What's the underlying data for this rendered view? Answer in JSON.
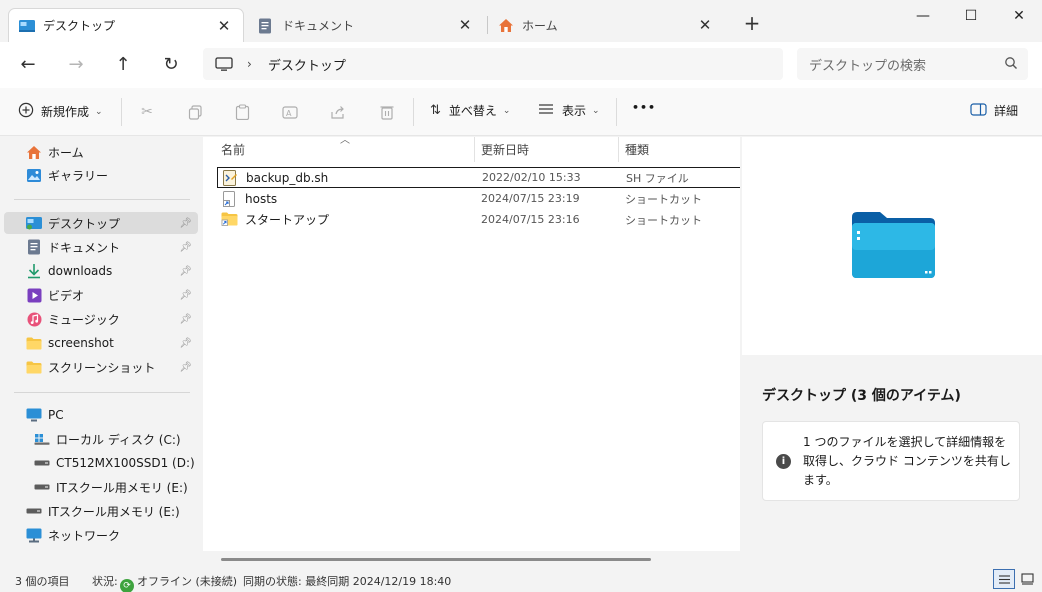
{
  "tabs": [
    {
      "label": "デスクトップ",
      "icon": "desktop-icon",
      "active": true
    },
    {
      "label": "ドキュメント",
      "icon": "document-icon",
      "active": false
    },
    {
      "label": "ホーム",
      "icon": "home-icon",
      "active": false
    }
  ],
  "new_tab_label": "+",
  "window_controls": {
    "minimize": "—",
    "maximize": "☐",
    "close": "✕"
  },
  "nav": {
    "back": "←",
    "forward": "→",
    "up": "↑",
    "refresh": "↻"
  },
  "address": {
    "chevron": "›",
    "path": "デスクトップ"
  },
  "search": {
    "placeholder": "デスクトップの検索"
  },
  "commandbar": {
    "new_label": "新規作成",
    "sort_label": "並べ替え",
    "view_label": "表示",
    "more_label": "•••",
    "details_label": "詳細"
  },
  "sidebar": {
    "top": [
      {
        "label": "ホーム",
        "icon": "home-icon"
      },
      {
        "label": "ギャラリー",
        "icon": "gallery-icon"
      }
    ],
    "quick": [
      {
        "label": "デスクトップ",
        "icon": "desktop-icon",
        "pinned": true,
        "selected": true
      },
      {
        "label": "ドキュメント",
        "icon": "document-icon",
        "pinned": true
      },
      {
        "label": "downloads",
        "icon": "download-icon",
        "pinned": true
      },
      {
        "label": "ビデオ",
        "icon": "video-icon",
        "pinned": true
      },
      {
        "label": "ミュージック",
        "icon": "music-icon",
        "pinned": true
      },
      {
        "label": "screenshot",
        "icon": "folder-icon",
        "pinned": true
      },
      {
        "label": "スクリーンショット",
        "icon": "folder-icon",
        "pinned": true
      }
    ],
    "pc": {
      "label": "PC",
      "icon": "pc-icon"
    },
    "drives": [
      {
        "label": "ローカル ディスク (C:)",
        "icon": "drive-icon"
      },
      {
        "label": "CT512MX100SSD1 (D:)",
        "icon": "drive-icon"
      },
      {
        "label": "ITスクール用メモリ (E:)",
        "icon": "usb-drive-icon"
      }
    ],
    "bottom": [
      {
        "label": "ITスクール用メモリ (E:)",
        "icon": "usb-drive-icon"
      },
      {
        "label": "ネットワーク",
        "icon": "network-icon"
      }
    ]
  },
  "columns": {
    "name": "名前",
    "modified": "更新日時",
    "type": "種類"
  },
  "files": [
    {
      "name": "backup_db.sh",
      "modified": "2022/02/10 15:33",
      "type": "SH ファイル",
      "icon": "script-file-icon"
    },
    {
      "name": "hosts",
      "modified": "2024/07/15 23:19",
      "type": "ショートカット",
      "icon": "shortcut-file-icon"
    },
    {
      "name": "スタートアップ",
      "modified": "2024/07/15 23:16",
      "type": "ショートカット",
      "icon": "folder-shortcut-icon"
    }
  ],
  "details": {
    "title": "デスクトップ (3 個のアイテム)",
    "info": "1 つのファイルを選択して詳細情報を取得し、クラウド コンテンツを共有します。"
  },
  "status": {
    "count": "3 個の項目",
    "state_label": "状況:",
    "state_value": "オフライン (未接続)",
    "sync": "同期の状態:  最終同期 2024/12/19 18:40"
  },
  "colors": {
    "accent": "#0067c0",
    "folder": "#f6c544",
    "selected_bg": "#dcdcdc"
  }
}
